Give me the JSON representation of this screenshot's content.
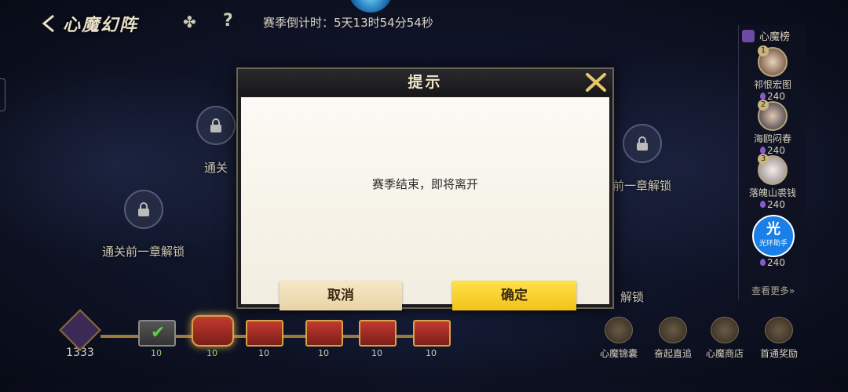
{
  "header": {
    "title": "心魔幻阵",
    "countdown": "赛季倒计时：5天13时54分54秒",
    "icons": [
      "back-icon",
      "ranking-icon",
      "help-icon"
    ],
    "help_glyph": "?"
  },
  "map_nodes": [
    {
      "label": "通关",
      "locked": true
    },
    {
      "label": "前一章解锁",
      "locked": true
    },
    {
      "label": "通关前一章解锁",
      "locked": true
    },
    {
      "label": "解锁",
      "locked": true
    }
  ],
  "dialog": {
    "title": "提示",
    "message": "赛季结束，即将离开",
    "cancel_label": "取消",
    "confirm_label": "确定"
  },
  "leaderboard": {
    "title": "心魔榜",
    "entries": [
      {
        "rank": "1",
        "name": "祁恨宏图",
        "score": "240"
      },
      {
        "rank": "2",
        "name": "海鸥闷春",
        "score": "240"
      },
      {
        "rank": "3",
        "name": "落魄山裘钱",
        "score": "240"
      },
      {
        "rank": "",
        "name": "",
        "score": "240"
      }
    ],
    "helper_big": "光",
    "helper_small": "光环助手",
    "more_label": "查看更多»"
  },
  "currency": {
    "value": "1333"
  },
  "chests": [
    {
      "count": "10",
      "state": "opened"
    },
    {
      "count": "10",
      "state": "current"
    },
    {
      "count": "10",
      "state": "closed"
    },
    {
      "count": "10",
      "state": "closed"
    },
    {
      "count": "10",
      "state": "closed"
    },
    {
      "count": "10",
      "state": "closed"
    }
  ],
  "bottom_buttons": [
    {
      "label": "心魔锦囊",
      "icon": "pouch-icon"
    },
    {
      "label": "奋起直追",
      "icon": "boot-icon"
    },
    {
      "label": "心魔商店",
      "icon": "shop-icon"
    },
    {
      "label": "首通奖励",
      "icon": "reward-icon"
    }
  ],
  "colors": {
    "confirm": "#f2c21a",
    "cancel": "#ecd9b0",
    "accent": "#d6a347"
  }
}
